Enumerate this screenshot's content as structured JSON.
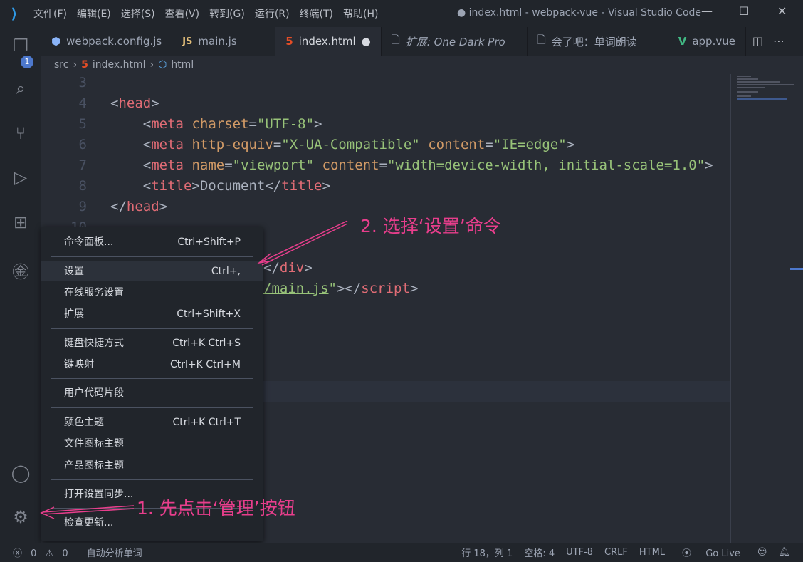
{
  "titlebar": {
    "menus": [
      "文件(F)",
      "编辑(E)",
      "选择(S)",
      "查看(V)",
      "转到(G)",
      "运行(R)",
      "终端(T)",
      "帮助(H)"
    ],
    "title": "● index.html - webpack-vue - Visual Studio Code"
  },
  "activity": {
    "explorer_badge": "1"
  },
  "tabs": [
    {
      "icon": "webpack-icon",
      "label": "webpack.config.js"
    },
    {
      "icon": "JS",
      "label": "main.js"
    },
    {
      "icon": "html5-icon",
      "label": "index.html",
      "modified": "●"
    },
    {
      "icon": "file-icon",
      "label": "扩展: One Dark Pro"
    },
    {
      "icon": "file-icon",
      "label": "会了吧：单词朗读"
    },
    {
      "icon": "vue-icon",
      "label": "app.vue"
    }
  ],
  "breadcrumb": [
    "src",
    "index.html",
    "html"
  ],
  "code": {
    "lines": [
      {
        "n": "3",
        "html": ""
      },
      {
        "n": "4",
        "html": "<span class='p'>&lt;</span><span class='t'>head</span><span class='p'>&gt;</span>"
      },
      {
        "n": "5",
        "html": "    <span class='p'>&lt;</span><span class='t'>meta</span> <span class='a'>charset</span><span class='p'>=</span><span class='s'>\"UTF-8\"</span><span class='p'>&gt;</span>"
      },
      {
        "n": "6",
        "html": "    <span class='p'>&lt;</span><span class='t'>meta</span> <span class='a'>http-equiv</span><span class='p'>=</span><span class='s'>\"X-UA-Compatible\"</span> <span class='a'>content</span><span class='p'>=</span><span class='s'>\"IE=edge\"</span><span class='p'>&gt;</span>"
      },
      {
        "n": "7",
        "html": "    <span class='p'>&lt;</span><span class='t'>meta</span> <span class='a'>name</span><span class='p'>=</span><span class='s'>\"viewport\"</span> <span class='a'>content</span><span class='p'>=</span><span class='s'>\"width=device-width, initial-scale=1.0\"</span><span class='p'>&gt;</span>"
      },
      {
        "n": "8",
        "html": "    <span class='p'>&lt;</span><span class='t'>title</span><span class='p'>&gt;Document&lt;/</span><span class='t'>title</span><span class='p'>&gt;</span>"
      },
      {
        "n": "9",
        "html": "<span class='p'>&lt;/</span><span class='t'>head</span><span class='p'>&gt;</span>"
      },
      {
        "n": "10",
        "html": ""
      }
    ],
    "partial_lines": [
      {
        "html": "<span class='p'>&lt;/</span><span class='t'>div</span><span class='p'>&gt;</span>"
      },
      {
        "html": "<span class='s' style='text-decoration:underline'>/main.js</span><span class='s'>\"</span><span class='p'>&gt;&lt;/</span><span class='t'>script</span><span class='p'>&gt;</span>"
      }
    ]
  },
  "context_menu": {
    "items": [
      {
        "label": "命令面板...",
        "shortcut": "Ctrl+Shift+P"
      },
      {
        "label": "设置",
        "shortcut": "Ctrl+,",
        "highlighted": true
      },
      {
        "label": "在线服务设置",
        "shortcut": ""
      },
      {
        "label": "扩展",
        "shortcut": "Ctrl+Shift+X"
      },
      {
        "label": "键盘快捷方式",
        "shortcut": "Ctrl+K Ctrl+S"
      },
      {
        "label": "键映射",
        "shortcut": "Ctrl+K Ctrl+M"
      },
      {
        "label": "用户代码片段",
        "shortcut": ""
      },
      {
        "label": "颜色主题",
        "shortcut": "Ctrl+K Ctrl+T"
      },
      {
        "label": "文件图标主题",
        "shortcut": ""
      },
      {
        "label": "产品图标主题",
        "shortcut": ""
      },
      {
        "label": "打开设置同步...",
        "shortcut": ""
      },
      {
        "label": "检查更新...",
        "shortcut": ""
      }
    ]
  },
  "annotations": {
    "step1": "1. 先点击‘管理’按钮",
    "step2": "2. 选择‘设置’命令",
    "color": "#e83e8c"
  },
  "status": {
    "errors": "0",
    "warnings": "0",
    "ext": "自动分析单词",
    "position": "行 18，列 1",
    "spaces": "空格: 4",
    "encoding": "UTF-8",
    "eol": "CRLF",
    "language": "HTML",
    "golive": "Go Live"
  }
}
